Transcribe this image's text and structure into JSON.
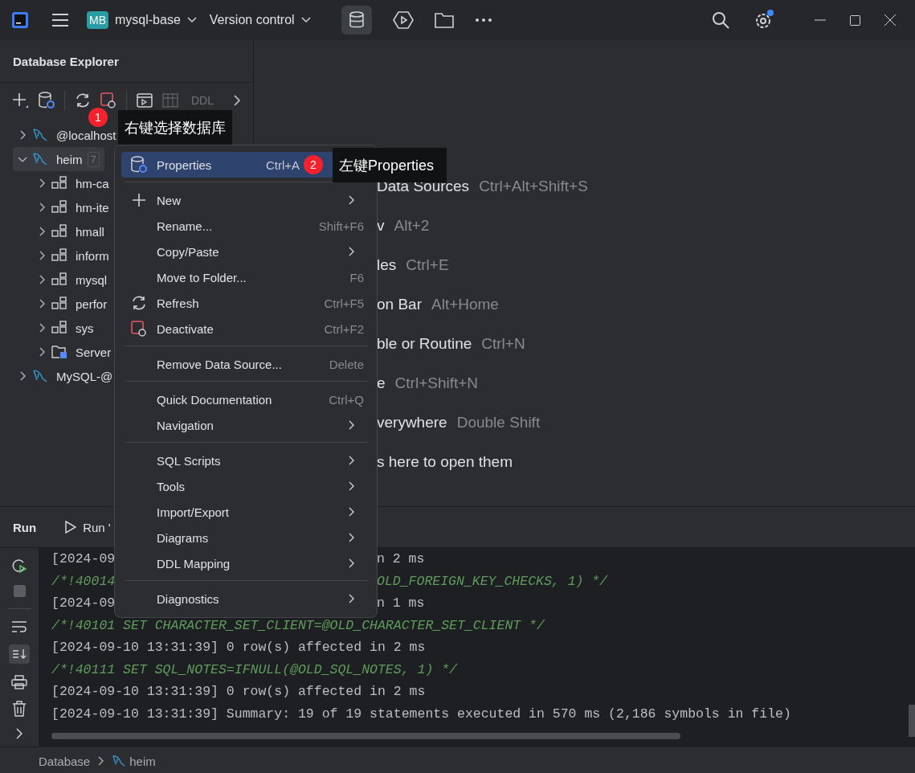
{
  "titlebar": {
    "project_badge": "MB",
    "project": "mysql-base",
    "vcs": "Version control"
  },
  "explorer": {
    "title": "Database Explorer",
    "toolbar_ddl": "DDL",
    "tree": [
      {
        "label": "@localhost",
        "kind": "datasource",
        "expanded": false,
        "selected": false
      },
      {
        "label": "heim",
        "count": "7",
        "kind": "datasource",
        "expanded": true,
        "selected": true,
        "children": [
          {
            "label": "hm-ca",
            "kind": "schema",
            "expanded": false,
            "selected": false
          },
          {
            "label": "hm-ite",
            "kind": "schema",
            "expanded": false,
            "selected": false
          },
          {
            "label": "hmall",
            "kind": "schema",
            "expanded": false,
            "selected": false
          },
          {
            "label": "inform",
            "kind": "schema",
            "expanded": false,
            "selected": false
          },
          {
            "label": "mysql",
            "kind": "schema",
            "expanded": false,
            "selected": false
          },
          {
            "label": "perfor",
            "kind": "schema",
            "expanded": false,
            "selected": false
          },
          {
            "label": "sys",
            "kind": "schema",
            "expanded": false,
            "selected": false
          },
          {
            "label": "Server",
            "kind": "folder",
            "expanded": false,
            "selected": false
          }
        ]
      },
      {
        "label": "MySQL-@",
        "kind": "datasource",
        "expanded": false,
        "selected": false
      }
    ]
  },
  "welcome": [
    {
      "label": "Data Sources",
      "shortcut": "Ctrl+Alt+Shift+S"
    },
    {
      "label": "v",
      "shortcut": "Alt+2"
    },
    {
      "label": "les",
      "shortcut": "Ctrl+E"
    },
    {
      "label": "on Bar",
      "shortcut": "Alt+Home"
    },
    {
      "label": "ble or Routine",
      "shortcut": "Ctrl+N"
    },
    {
      "label": "e",
      "shortcut": "Ctrl+Shift+N"
    },
    {
      "label": "verywhere",
      "shortcut": "Double Shift"
    },
    {
      "label": "s here to open them"
    }
  ],
  "run": {
    "tabs": [
      {
        "label": "Run",
        "selected": true
      },
      {
        "label": "Run '",
        "selected": false
      }
    ],
    "lines": [
      {
        "kind": "info",
        "text": "[2024-09",
        "tail": "n 2 ms"
      },
      {
        "kind": "comment",
        "text": "/*!40014",
        "tail": "OLD_FOREIGN_KEY_CHECKS, 1) */"
      },
      {
        "kind": "info",
        "text": "[2024-09",
        "tail": "n 1 ms"
      },
      {
        "kind": "comment",
        "text": "/*!40101 SET CHARACTER_SET_CLIENT=@OLD_CHARACTER_SET_CLIENT */"
      },
      {
        "kind": "info",
        "text": "[2024-09-10 13:31:39] 0 row(s) affected in 2 ms"
      },
      {
        "kind": "comment",
        "text": "/*!40111 SET SQL_NOTES=IFNULL(@OLD_SQL_NOTES, 1) */"
      },
      {
        "kind": "info",
        "text": "[2024-09-10 13:31:39] 0 row(s) affected in 2 ms"
      },
      {
        "kind": "info",
        "text": "[2024-09-10 13:31:39] Summary: 19 of 19 statements executed in 570 ms (2,186 symbols in file)"
      }
    ]
  },
  "status": {
    "crumbs": [
      {
        "label": "Database",
        "kind": "text"
      },
      {
        "label": "heim",
        "kind": "datasource"
      }
    ]
  },
  "menu": [
    {
      "kind": "item",
      "label": "Properties",
      "shortcut": "Ctrl+A",
      "submenu": false,
      "selected": true
    },
    {
      "kind": "separator"
    },
    {
      "kind": "item",
      "label": "New",
      "submenu": true,
      "selected": false
    },
    {
      "kind": "item",
      "label": "Rename...",
      "shortcut": "Shift+F6",
      "submenu": false,
      "selected": false
    },
    {
      "kind": "item",
      "label": "Copy/Paste",
      "submenu": true,
      "selected": false
    },
    {
      "kind": "item",
      "label": "Move to Folder...",
      "shortcut": "F6",
      "submenu": false,
      "selected": false
    },
    {
      "kind": "item",
      "label": "Refresh",
      "shortcut": "Ctrl+F5",
      "submenu": false,
      "selected": false
    },
    {
      "kind": "item",
      "label": "Deactivate",
      "shortcut": "Ctrl+F2",
      "submenu": false,
      "selected": false
    },
    {
      "kind": "separator"
    },
    {
      "kind": "item",
      "label": "Remove Data Source...",
      "shortcut": "Delete",
      "submenu": false,
      "selected": false
    },
    {
      "kind": "separator"
    },
    {
      "kind": "item",
      "label": "Quick Documentation",
      "shortcut": "Ctrl+Q",
      "submenu": false,
      "selected": false
    },
    {
      "kind": "item",
      "label": "Navigation",
      "submenu": true,
      "selected": false
    },
    {
      "kind": "separator"
    },
    {
      "kind": "item",
      "label": "SQL Scripts",
      "submenu": true,
      "selected": false
    },
    {
      "kind": "item",
      "label": "Tools",
      "submenu": true,
      "selected": false
    },
    {
      "kind": "item",
      "label": "Import/Export",
      "submenu": true,
      "selected": false
    },
    {
      "kind": "item",
      "label": "Diagrams",
      "submenu": true,
      "selected": false
    },
    {
      "kind": "item",
      "label": "DDL Mapping",
      "submenu": true,
      "selected": false
    },
    {
      "kind": "separator"
    },
    {
      "kind": "item",
      "label": "Diagnostics",
      "submenu": true,
      "selected": false
    }
  ],
  "annotations": [
    {
      "number": "1",
      "text": "右键选择数据库"
    },
    {
      "number": "2",
      "text": "左键Properties"
    }
  ]
}
